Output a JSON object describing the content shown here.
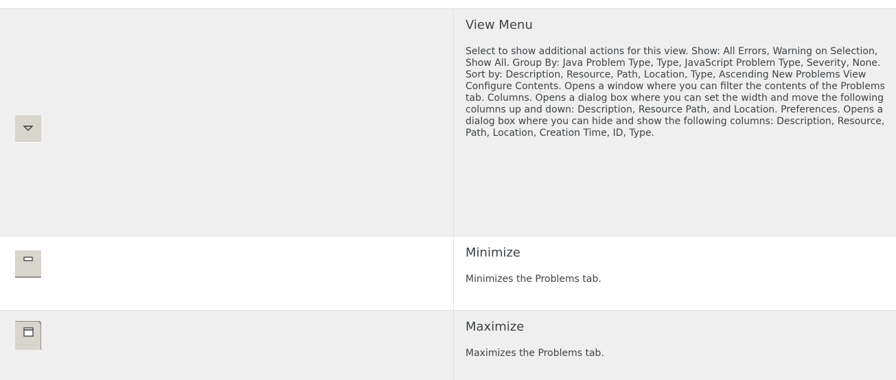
{
  "rows": [
    {
      "icon": "view-menu-icon",
      "title": "View Menu",
      "description": "Select to show additional actions for this view. Show: All Errors, Warning on Selection, Show All. Group By: Java Problem Type, Type, JavaScript Problem Type, Severity, None. Sort by: Description, Resource, Path, Location, Type, Ascending New Problems View Configure Contents. Opens a window where you can filter the contents of the Problems tab. Columns. Opens a dialog box where you can set the width and move the following columns up and down: Description, Resource Path, and Location. Preferences. Opens a dialog box where you can hide and show the following columns: Description, Resource, Path, Location, Creation Time, ID, Type."
    },
    {
      "icon": "minimize-icon",
      "title": "Minimize",
      "description": "Minimizes the Problems tab."
    },
    {
      "icon": "maximize-icon",
      "title": "Maximize",
      "description": "Maximizes the Problems tab."
    }
  ],
  "colors": {
    "shaded_row": "#efefef",
    "border": "#dfe3e6",
    "icon_button": "#d7d5cd",
    "text": "#3e4347"
  }
}
